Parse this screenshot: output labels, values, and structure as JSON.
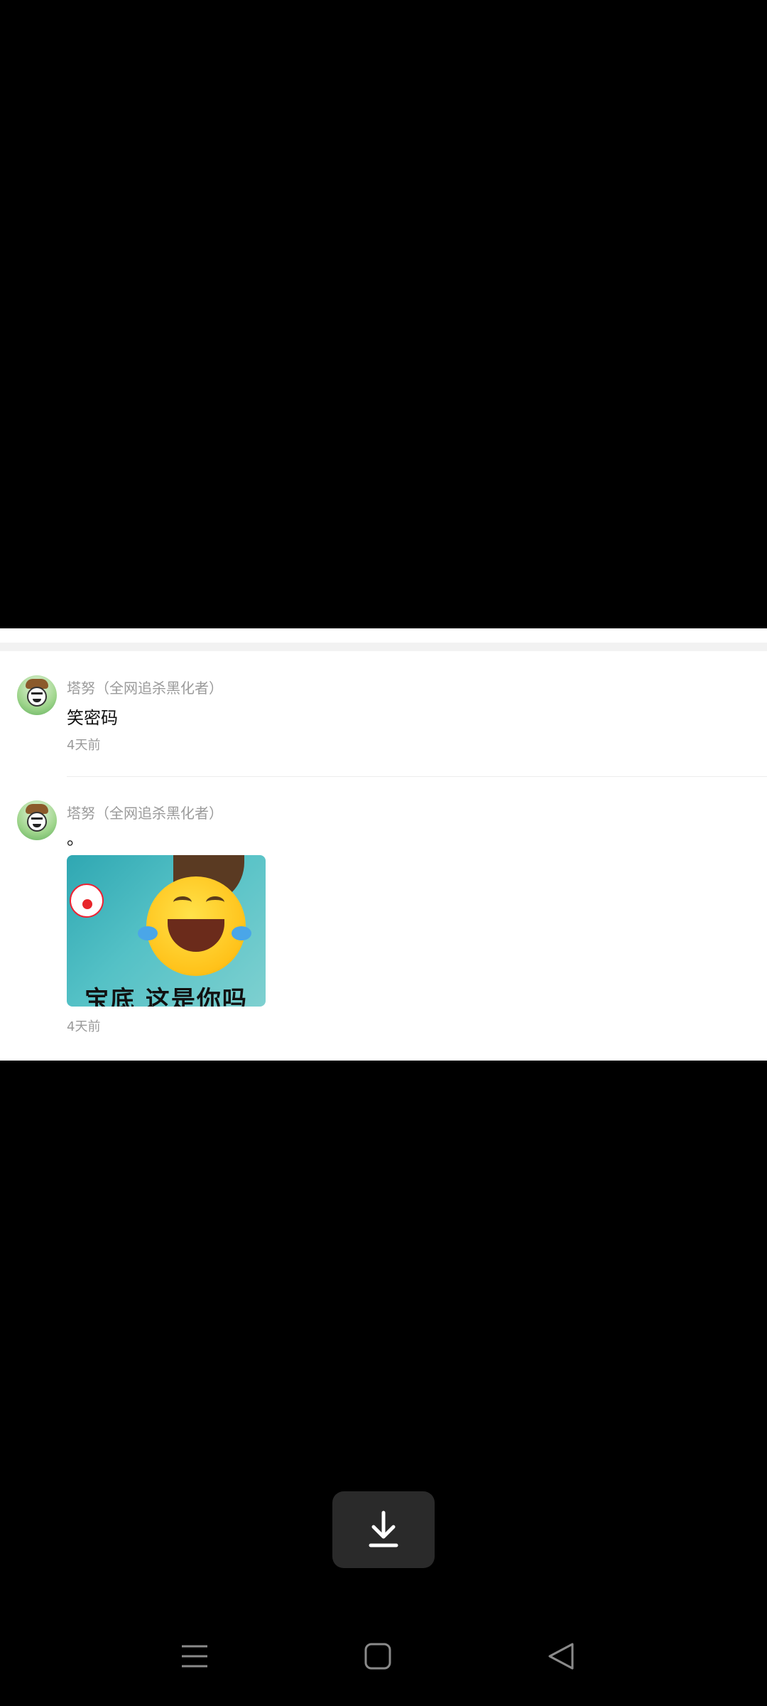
{
  "comments": [
    {
      "username": "塔努（全网追杀黑化者）",
      "text": "笑密码",
      "time": "4天前",
      "avatar_icon": "cowboy-avatar-icon"
    },
    {
      "username": "塔努（全网追杀黑化者）",
      "text": "。",
      "time": "4天前",
      "avatar_icon": "cowboy-avatar-icon",
      "sticker": {
        "caption": "宝底 这是你吗",
        "icon": "laughing-emoji-sticker-icon"
      }
    }
  ],
  "download_button": {
    "icon": "download-icon"
  },
  "navbar": {
    "buttons": [
      {
        "name": "menu",
        "icon": "menu-icon"
      },
      {
        "name": "home",
        "icon": "home-square-icon"
      },
      {
        "name": "back",
        "icon": "back-triangle-icon"
      }
    ]
  },
  "colors": {
    "background": "#000000",
    "card": "#ffffff",
    "meta_text": "#9a9a9a",
    "body_text": "#111111"
  }
}
